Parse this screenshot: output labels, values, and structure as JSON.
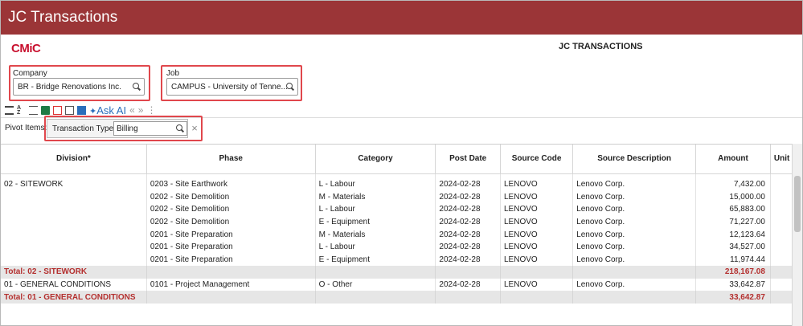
{
  "window": {
    "title": "JC Transactions"
  },
  "brand": {
    "logo_text": "CMiC"
  },
  "page": {
    "title": "JC TRANSACTIONS"
  },
  "filters": {
    "company": {
      "label": "Company",
      "value": "BR - Bridge Renovations Inc."
    },
    "job": {
      "label": "Job",
      "value": "CAMPUS - University of Tenne..."
    }
  },
  "toolbar": {
    "ask_star": "✦",
    "ask_label": "Ask AI",
    "prev": "«",
    "next": "»",
    "more": "⋮"
  },
  "pivot": {
    "label": "Pivot Items:",
    "item_label": "Transaction Type",
    "item_value": "Billing",
    "close": "×"
  },
  "table": {
    "columns": [
      "Division*",
      "Phase",
      "Category",
      "Post Date",
      "Source Code",
      "Source Description",
      "Amount",
      "Unit"
    ],
    "rows": [
      {
        "type": "data",
        "cells": [
          "02 - SITEWORK",
          "0203 - Site Earthwork",
          "L - Labour",
          "2024-02-28",
          "LENOVO",
          "Lenovo Corp.",
          "7,432.00"
        ]
      },
      {
        "type": "data",
        "cells": [
          "",
          "0202 - Site Demolition",
          "M - Materials",
          "2024-02-28",
          "LENOVO",
          "Lenovo Corp.",
          "15,000.00"
        ]
      },
      {
        "type": "data",
        "cells": [
          "",
          "0202 - Site Demolition",
          "L - Labour",
          "2024-02-28",
          "LENOVO",
          "Lenovo Corp.",
          "65,883.00"
        ]
      },
      {
        "type": "data",
        "cells": [
          "",
          "0202 - Site Demolition",
          "E - Equipment",
          "2024-02-28",
          "LENOVO",
          "Lenovo Corp.",
          "71,227.00"
        ]
      },
      {
        "type": "data",
        "cells": [
          "",
          "0201 - Site Preparation",
          "M - Materials",
          "2024-02-28",
          "LENOVO",
          "Lenovo Corp.",
          "12,123.64"
        ]
      },
      {
        "type": "data",
        "cells": [
          "",
          "0201 - Site Preparation",
          "L - Labour",
          "2024-02-28",
          "LENOVO",
          "Lenovo Corp.",
          "34,527.00"
        ]
      },
      {
        "type": "data",
        "cells": [
          "",
          "0201 - Site Preparation",
          "E - Equipment",
          "2024-02-28",
          "LENOVO",
          "Lenovo Corp.",
          "11,974.44"
        ]
      },
      {
        "type": "total",
        "cells": [
          "Total: 02 - SITEWORK",
          "",
          "",
          "",
          "",
          "",
          "218,167.08"
        ]
      },
      {
        "type": "data",
        "cells": [
          "01 - GENERAL CONDITIONS",
          "0101 - Project Management",
          "O - Other",
          "2024-02-28",
          "LENOVO",
          "Lenovo Corp.",
          "33,642.87"
        ]
      },
      {
        "type": "total",
        "cells": [
          "Total: 01 - GENERAL CONDITIONS",
          "",
          "",
          "",
          "",
          "",
          "33,642.87"
        ]
      }
    ]
  }
}
